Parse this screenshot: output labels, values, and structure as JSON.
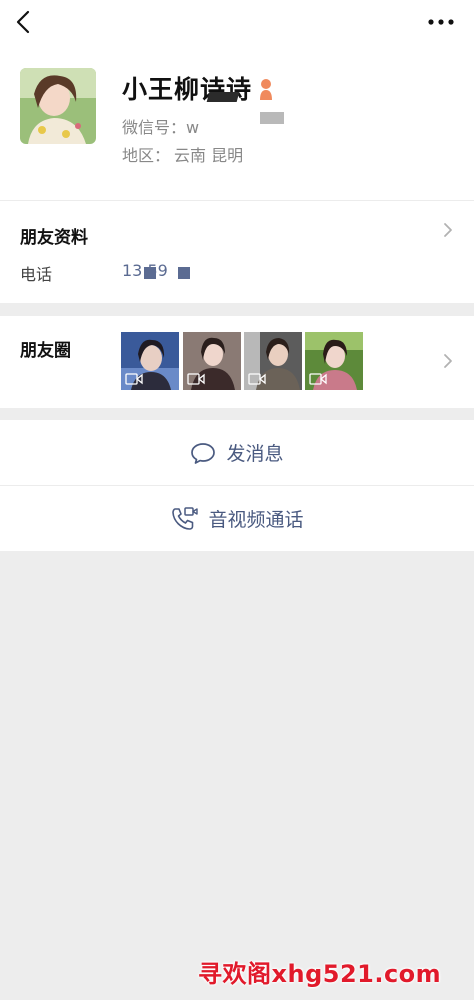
{
  "profile": {
    "name": "小王柳诗诗",
    "wechat_id_label": "微信号：",
    "wechat_id_value": "w",
    "region_label": "地区：",
    "region_value": "云南  昆明"
  },
  "friend_info": {
    "title": "朋友资料",
    "phone_label": "电话",
    "phone_value_visible": "13        59"
  },
  "moments": {
    "title": "朋友圈",
    "thumbnails": [
      "video-thumb-1",
      "video-thumb-2",
      "video-thumb-3",
      "video-thumb-4"
    ]
  },
  "actions": {
    "message_label": "发消息",
    "call_label": "音视频通话"
  },
  "watermark": {
    "text": "寻欢阁xhg521.com"
  },
  "colors": {
    "page_bg": "#ededed",
    "card_bg": "#ffffff",
    "link_blue": "#4a5a80",
    "watermark_red": "#e11a2b"
  },
  "icons": [
    "back-icon",
    "more-icon",
    "female-icon",
    "chevron-right-icon",
    "chat-bubble-icon",
    "video-call-icon",
    "video-icon"
  ]
}
